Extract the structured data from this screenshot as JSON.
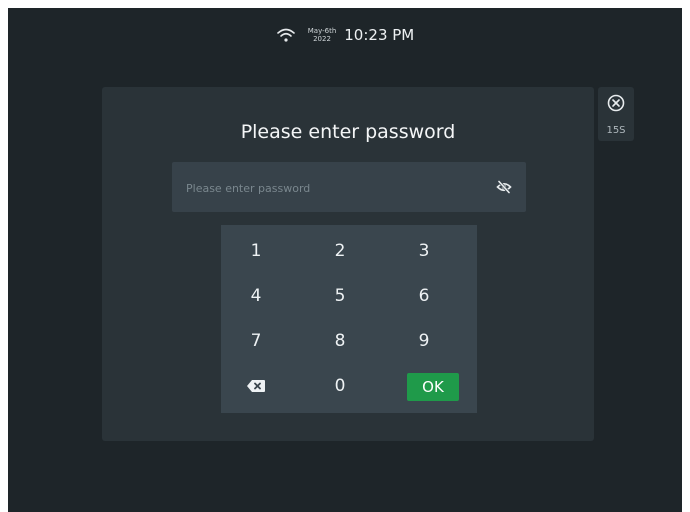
{
  "status_bar": {
    "date_top": "May-6th",
    "date_bottom": "2022",
    "time": "10:23 PM",
    "wifi_icon": "wifi-icon"
  },
  "dialog": {
    "title": "Please enter password",
    "input_placeholder": "Please enter password",
    "input_value": "",
    "visibility_icon": "eye-slash-icon"
  },
  "keypad": {
    "keys": [
      "1",
      "2",
      "3",
      "4",
      "5",
      "6",
      "7",
      "8",
      "9",
      "0"
    ],
    "backspace_icon": "backspace-icon",
    "ok_label": "OK"
  },
  "close_panel": {
    "close_icon": "close-circle-icon",
    "countdown": "15S"
  },
  "colors": {
    "background": "#1e2529",
    "dialog": "#2a3338",
    "field": "#37424a",
    "keypad": "#3a464e",
    "accent_ok": "#1f9a4a"
  }
}
